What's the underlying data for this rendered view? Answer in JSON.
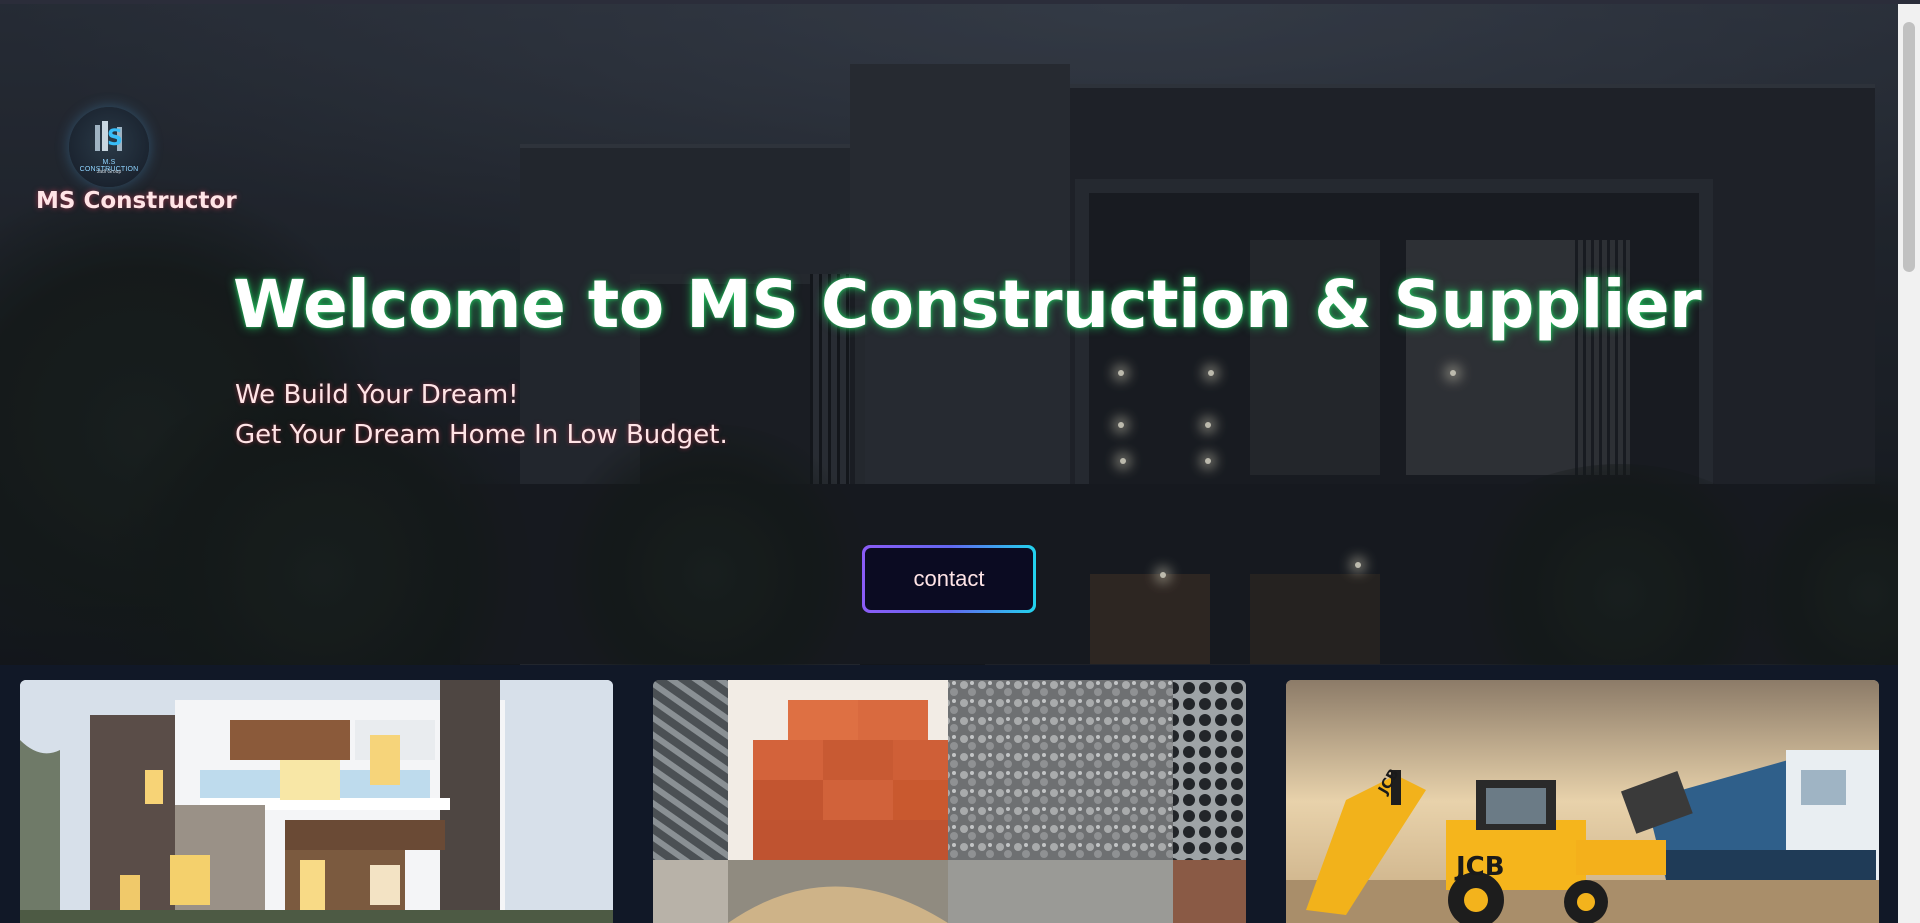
{
  "brand": {
    "logo_text": "M.S CONSTRUCTION",
    "logo_tagline": "Jadi Group",
    "name": "MS Constructor"
  },
  "hero": {
    "headline": "Welcome to MS Construction & Supplier",
    "subline_1": "We Build Your Dream!",
    "subline_2": "Get Your Dream Home In Low Budget.",
    "contact_label": "contact"
  },
  "cards": [
    {
      "icon": "modern-house-image"
    },
    {
      "icon": "construction-materials-image"
    },
    {
      "icon": "construction-machinery-image"
    }
  ],
  "colors": {
    "headline_glow": "#22c55e",
    "accent_text": "#ffe4e6",
    "button_gradient_start": "#8b5cf6",
    "button_gradient_end": "#22d3ee",
    "button_fill": "#0b0b22"
  }
}
